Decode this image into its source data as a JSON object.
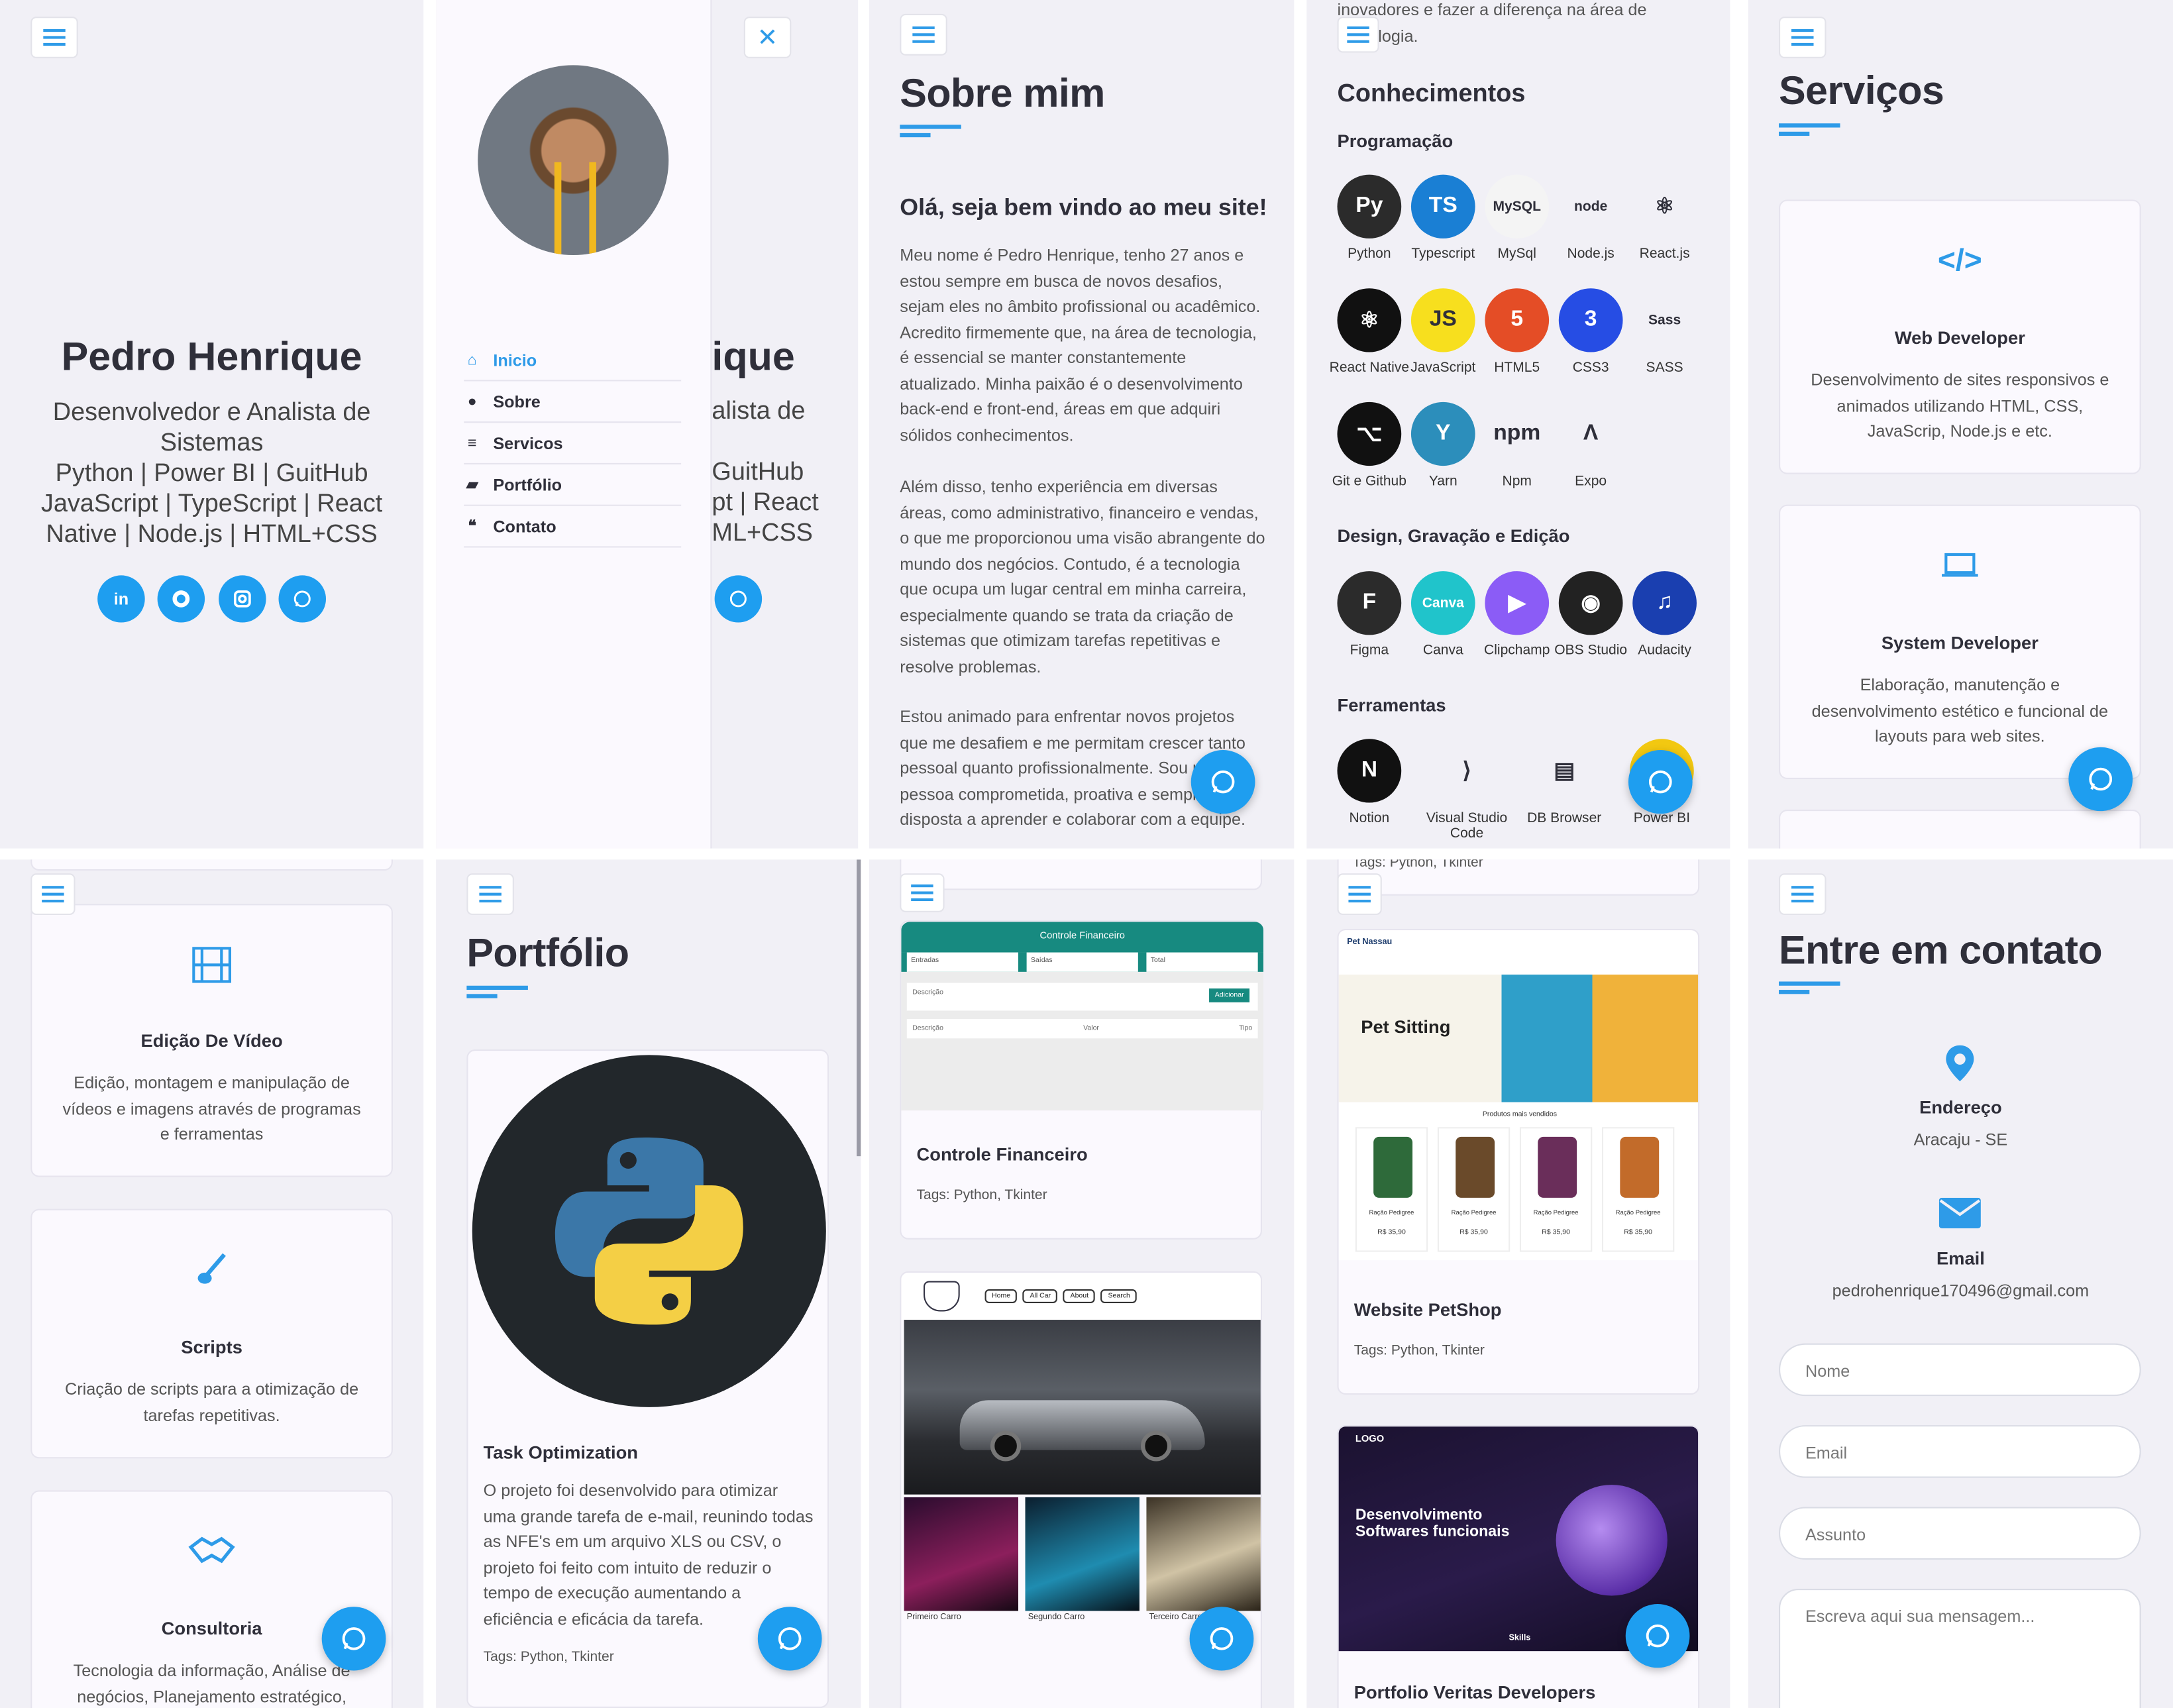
{
  "hero": {
    "name": "Pedro Henrique",
    "role": "Desenvolvedor e Analista de Sistemas",
    "stack": "Python | Power BI | GuitHub JavaScript | TypeScript | React Native | Node.js | HTML+CSS",
    "social": [
      "linkedin-icon",
      "github-icon",
      "instagram-icon",
      "whatsapp-icon"
    ]
  },
  "nav": {
    "items": [
      {
        "label": "Inicio",
        "icon": "home-icon",
        "active": true
      },
      {
        "label": "Sobre",
        "icon": "user-icon",
        "active": false
      },
      {
        "label": "Servicos",
        "icon": "list-icon",
        "active": false
      },
      {
        "label": "Portfólio",
        "icon": "briefcase-icon",
        "active": false
      },
      {
        "label": "Contato",
        "icon": "comments-icon",
        "active": false
      }
    ],
    "behind_name": "ique",
    "behind_role": "alista de",
    "behind_stack1": "GuitHub",
    "behind_stack2": "pt | React",
    "behind_stack3": "ML+CSS"
  },
  "about": {
    "title": "Sobre mim",
    "greeting": "Olá, seja bem vindo ao meu site!",
    "p1": "Meu nome é Pedro Henrique, tenho 27 anos e estou sempre em busca de novos desafios, sejam eles no âmbito profissional ou acadêmico. Acredito firmemente que, na área de tecnologia, é essencial se manter constantemente atualizado. Minha paixão é o desenvolvimento back-end e front-end, áreas em que adquiri sólidos conhecimentos.",
    "p2": "Além disso, tenho experiência em diversas áreas, como administrativo, financeiro e vendas, o que me proporcionou uma visão abrangente do mundo dos negócios. Contudo, é a tecnologia que ocupa um lugar central em minha carreira, especialmente quando se trata da criação de sistemas que otimizam tarefas repetitivas e resolve problemas.",
    "p3": "Estou animado para enfrentar novos projetos que me desafiem e me permitam crescer tanto pessoal quanto profissionalmente. Sou uma pessoa comprometida, proativa e sempre disposta a aprender e colaborar com a equipe."
  },
  "skills": {
    "top_text": "inovadores e fazer a diferença na área de tecnologia.",
    "title": "Conhecimentos",
    "programming_title": "Programação",
    "programming": [
      {
        "label": "Python",
        "icon": "python-icon",
        "color": "#2b2b2b",
        "glyph": "Py"
      },
      {
        "label": "Typescript",
        "icon": "typescript-icon",
        "color": "#1a7fd4",
        "glyph": "TS"
      },
      {
        "label": "MySql",
        "icon": "mysql-icon",
        "color": "#f4f4f4",
        "glyph": "MySQL"
      },
      {
        "label": "Node.js",
        "icon": "nodejs-icon",
        "color": "#f1f0f6",
        "glyph": "node"
      },
      {
        "label": "React.js",
        "icon": "react-icon",
        "color": "#f1f0f6",
        "glyph": "⚛"
      },
      {
        "label": "React Native",
        "icon": "react-native-icon",
        "color": "#111",
        "glyph": "⚛"
      },
      {
        "label": "JavaScript",
        "icon": "javascript-icon",
        "color": "#f7df1e",
        "glyph": "JS"
      },
      {
        "label": "HTML5",
        "icon": "html5-icon",
        "color": "#e44d26",
        "glyph": "5"
      },
      {
        "label": "CSS3",
        "icon": "css3-icon",
        "color": "#264de4",
        "glyph": "3"
      },
      {
        "label": "SASS",
        "icon": "sass-icon",
        "color": "#f1f0f6",
        "glyph": "Sass"
      },
      {
        "label": "Git e Github",
        "icon": "github-icon",
        "color": "#111",
        "glyph": "⌥"
      },
      {
        "label": "Yarn",
        "icon": "yarn-icon",
        "color": "#2c8ebb",
        "glyph": "Y"
      },
      {
        "label": "Npm",
        "icon": "npm-icon",
        "color": "#f1f0f6",
        "glyph": "npm"
      },
      {
        "label": "Expo",
        "icon": "expo-icon",
        "color": "#f1f0f6",
        "glyph": "Λ"
      }
    ],
    "design_title": "Design, Gravação e Edição",
    "design": [
      {
        "label": "Figma",
        "icon": "figma-icon",
        "color": "#2b2b2b",
        "glyph": "F"
      },
      {
        "label": "Canva",
        "icon": "canva-icon",
        "color": "#20c4cb",
        "glyph": "Canva"
      },
      {
        "label": "Clipchamp",
        "icon": "clipchamp-icon",
        "color": "#8b5cf6",
        "glyph": "▶"
      },
      {
        "label": "OBS Studio",
        "icon": "obs-icon",
        "color": "#222",
        "glyph": "◉"
      },
      {
        "label": "Audacity",
        "icon": "audacity-icon",
        "color": "#1a3fb0",
        "glyph": "♫"
      }
    ],
    "tools_title": "Ferramentas",
    "tools": [
      {
        "label": "Notion",
        "icon": "notion-icon",
        "color": "#111",
        "glyph": "N"
      },
      {
        "label": "Visual Studio Code",
        "icon": "vscode-icon",
        "color": "#f1f0f6",
        "glyph": "⟩"
      },
      {
        "label": "DB Browser",
        "icon": "db-browser-icon",
        "color": "#f1f0f6",
        "glyph": "▤"
      },
      {
        "label": "Power BI",
        "icon": "powerbi-icon",
        "color": "#f2c811",
        "glyph": "▮"
      }
    ]
  },
  "services": {
    "title": "Serviços",
    "items": [
      {
        "icon": "code-icon",
        "title": "Web Developer",
        "desc": "Desenvolvimento de sites responsivos e animados utilizando HTML, CSS, JavaScrip, Node.js e etc."
      },
      {
        "icon": "laptop-icon",
        "title": "System Developer",
        "desc": "Elaboração, manutenção e desenvolvimento estético e funcional de layouts para web sites."
      },
      {
        "icon": "film-icon",
        "title": "Edição De Vídeo",
        "desc": "Edição, montagem e manipulação de vídeos e imagens através de programas e ferramentas"
      },
      {
        "icon": "brush-icon",
        "title": "Scripts",
        "desc": "Criação de scripts para a otimização de tarefas repetitivas."
      },
      {
        "icon": "handshake-icon",
        "title": "Consultoria",
        "desc": "Tecnologia da informação, Análise de negócios, Planejamento estratégico, Gestão"
      }
    ]
  },
  "portfolio": {
    "title": "Portfólio",
    "projects": [
      {
        "title": "Task Optimization",
        "desc": "O projeto foi desenvolvido para otimizar uma grande tarefa de e-mail, reunindo todas as NFE's em um arquivo XLS ou CSV, o projeto foi feito com intuito de reduzir o tempo de execução aumentando a eficiência e eficácia da tarefa.",
        "tags": "Tags: Python, Tkinter"
      },
      {
        "title": "Controle Financeiro",
        "tags": "Tags: Python, Tkinter",
        "screen_title": "Controle Financeiro",
        "screen_cols": [
          "Entradas",
          "Saídas",
          "Total"
        ],
        "screen_fields": [
          "Descrição",
          "Valor",
          "Tipo"
        ],
        "screen_button": "Adicionar"
      },
      {
        "title": "Website PetShop",
        "tags": "Tags: Python, Tkinter",
        "screen_brand": "Pet Nassau",
        "screen_headline": "Pet Sitting",
        "screen_sub": "Produtos mais vendidos",
        "screen_products": [
          "Ração Pedigree",
          "Ração Pedigree",
          "Ração Pedigree",
          "Ração Pedigree"
        ],
        "screen_price": "R$ 35,90"
      },
      {
        "title": "Portfolio Veritas Developers",
        "screen_logo": "LOGO",
        "screen_headline": "Desenvolvimento Softwares funcionais",
        "screen_footer": "Skills"
      },
      {
        "car_site_labels": [
          "Primeiro Carro",
          "Segundo Carro",
          "Terceiro Carro"
        ],
        "car_site_nav": [
          "Home",
          "All Car",
          "About",
          "Search"
        ]
      }
    ],
    "partial_tags": "Tags: Python, Tkinter"
  },
  "contact": {
    "title": "Entre em contato",
    "address_label": "Endereço",
    "address_value": "Aracaju - SE",
    "email_label": "Email",
    "email_value": "pedrohenrique170496@gmail.com",
    "name_placeholder": "Nome",
    "email_placeholder": "Email",
    "subject_placeholder": "Assunto",
    "message_placeholder": "Escreva aqui sua mensagem..."
  },
  "colors": {
    "accent": "#2e9be8",
    "panel_bg": "#f1f0f6",
    "card_bg": "#fbf9fe",
    "dark_text": "#2f2f3a"
  }
}
